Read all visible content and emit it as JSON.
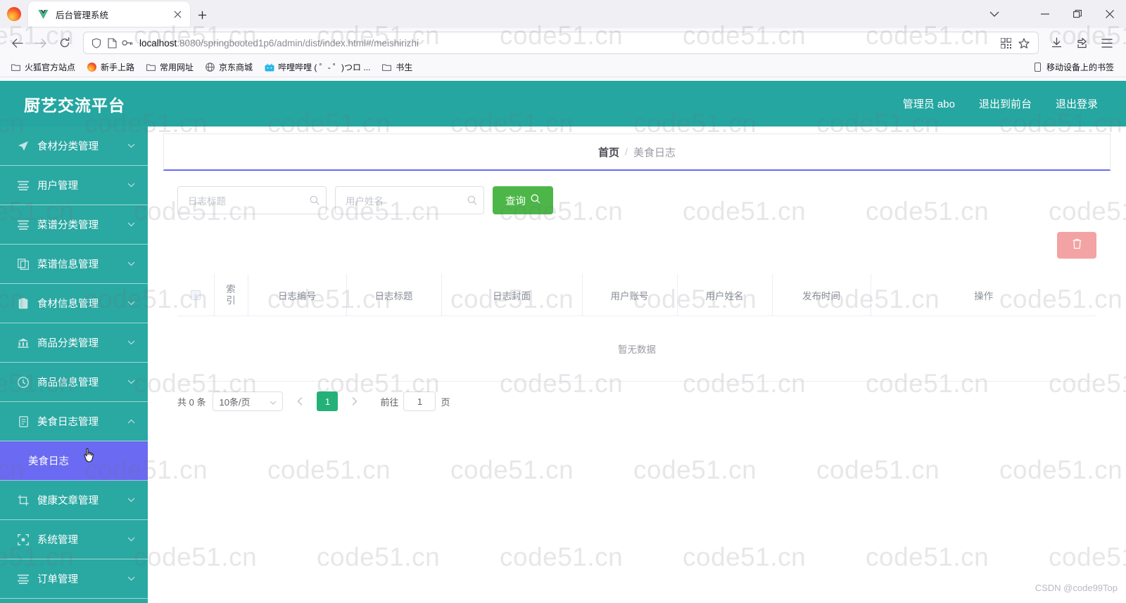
{
  "browser": {
    "tab": {
      "title": "后台管理系统",
      "favicon": "vue-logo-icon",
      "close_icon": "close-icon"
    },
    "new_tab_icon": "plus-icon",
    "tab_list_icon": "chevron-down-icon",
    "window": {
      "minimize": "minimize-icon",
      "maximize": "maximize-icon",
      "close": "close-icon"
    },
    "nav": {
      "back": "back-arrow-icon",
      "forward": "forward-arrow-icon",
      "reload": "reload-icon"
    },
    "url": {
      "protocol_host": "localhost",
      "rest": ":8080/springbooted1p6/admin/dist/index.html#/meishirizhi",
      "shield_icon": "shield-icon",
      "page_icon": "page-icon",
      "key_icon": "key-icon",
      "qr_icon": "qr-code-icon",
      "star_icon": "star-icon"
    },
    "toolbar_right": {
      "download": "download-icon",
      "pocket": "extension-icon",
      "menu": "hamburger-menu-icon"
    },
    "bookmarks": [
      {
        "label": "火狐官方站点",
        "icon": "folder-icon"
      },
      {
        "label": "新手上路",
        "icon": "firefox-icon"
      },
      {
        "label": "常用网址",
        "icon": "folder-icon"
      },
      {
        "label": "京东商城",
        "icon": "globe-icon"
      },
      {
        "label": "哔哩哔哩 ( ゜- ゜)つロ ...",
        "icon": "bilibili-icon"
      },
      {
        "label": "书生",
        "icon": "folder-icon"
      }
    ],
    "bookmarks_right": {
      "label": "移动设备上的书签",
      "icon": "mobile-icon"
    }
  },
  "app": {
    "brand": "厨艺交流平台",
    "header_links": [
      {
        "label": "管理员 abo",
        "name": "current-user"
      },
      {
        "label": "退出到前台",
        "name": "exit-to-frontend"
      },
      {
        "label": "退出登录",
        "name": "logout"
      }
    ],
    "sidebar": [
      {
        "label": "食材分类管理",
        "icon": "send-icon",
        "arrow": "chevron-down-icon",
        "active": false
      },
      {
        "label": "用户管理",
        "icon": "list-icon",
        "arrow": "chevron-down-icon",
        "active": false
      },
      {
        "label": "菜谱分类管理",
        "icon": "list-icon",
        "arrow": "chevron-down-icon",
        "active": false
      },
      {
        "label": "菜谱信息管理",
        "icon": "copy-icon",
        "arrow": "chevron-down-icon",
        "active": false
      },
      {
        "label": "食材信息管理",
        "icon": "clipboard-icon",
        "arrow": "chevron-down-icon",
        "active": false
      },
      {
        "label": "商品分类管理",
        "icon": "bank-icon",
        "arrow": "chevron-down-icon",
        "active": false
      },
      {
        "label": "商品信息管理",
        "icon": "clock-icon",
        "arrow": "chevron-down-icon",
        "active": false
      },
      {
        "label": "美食日志管理",
        "icon": "document-icon",
        "arrow": "chevron-up-icon",
        "active": false
      },
      {
        "label": "美食日志",
        "icon": "",
        "arrow": "",
        "active": true,
        "sub": true
      },
      {
        "label": "健康文章管理",
        "icon": "crop-icon",
        "arrow": "chevron-down-icon",
        "active": false
      },
      {
        "label": "系统管理",
        "icon": "frame-icon",
        "arrow": "chevron-down-icon",
        "active": false
      },
      {
        "label": "订单管理",
        "icon": "list-icon",
        "arrow": "chevron-down-icon",
        "active": false
      }
    ],
    "breadcrumb": {
      "home": "首页",
      "separator": "/",
      "current": "美食日志"
    },
    "search": {
      "title_placeholder": "日志标题",
      "title_value": "",
      "user_placeholder": "用户姓名",
      "user_value": "",
      "search_button": "查询",
      "search_icon": "search-icon",
      "input_suffix_icon": "search-icon"
    },
    "toolbar": {
      "delete_icon": "trash-icon",
      "delete_label": ""
    },
    "table": {
      "headers": [
        "",
        "索引",
        "日志编号",
        "日志标题",
        "日志封面",
        "用户账号",
        "用户姓名",
        "发布时间",
        "操作"
      ],
      "rows": [],
      "empty_text": "暂无数据",
      "select_all_icon": "checkbox-icon"
    },
    "pagination": {
      "total_text": "共 0 条",
      "page_size": "10条/页",
      "page_size_arrow": "chevron-down-icon",
      "prev_icon": "chevron-left-icon",
      "next_icon": "chevron-right-icon",
      "current_page": "1",
      "jump_prefix": "前往",
      "jump_value": "1",
      "jump_suffix": "页"
    },
    "colors": {
      "brand_teal": "#25a6a0",
      "sidebar_teal": "#2aa8a2",
      "active_submenu": "#6a6af2",
      "search_green": "#4cb748",
      "page_green": "#23b178",
      "delete_pink": "#f3a3a3"
    }
  },
  "watermark": {
    "text": "code51.cn",
    "credit": "CSDN @code99Top"
  }
}
